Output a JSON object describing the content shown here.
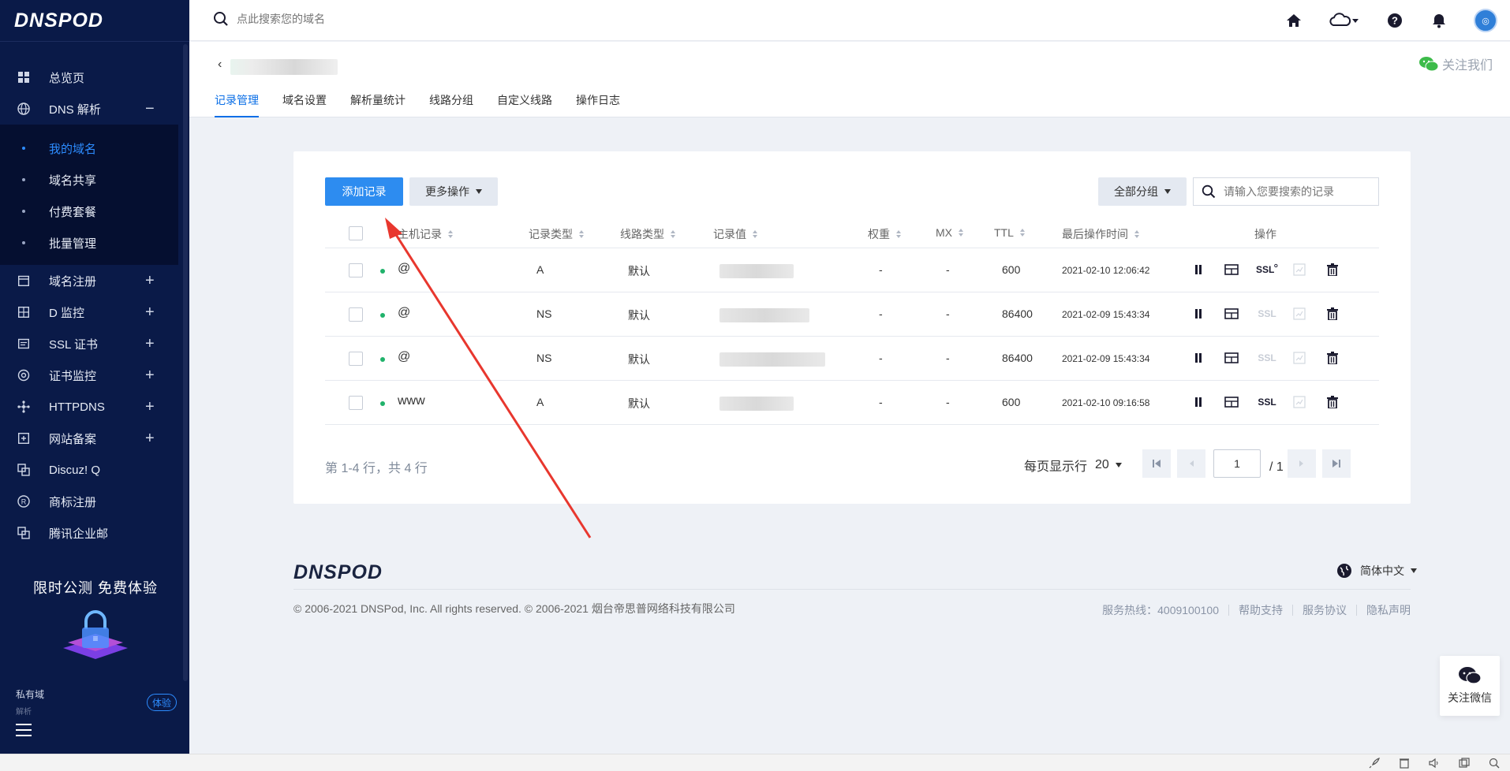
{
  "sidebar": {
    "logo": "DNSPOD",
    "items_top": [
      {
        "label": "总览页",
        "icon": "dashboard-icon"
      },
      {
        "label": "DNS 解析",
        "icon": "globe-icon",
        "toggle": "−"
      }
    ],
    "sub_items": [
      {
        "label": "我的域名",
        "active": true
      },
      {
        "label": "域名共享",
        "active": false
      },
      {
        "label": "付费套餐",
        "active": false
      },
      {
        "label": "批量管理",
        "active": false
      }
    ],
    "items_bottom": [
      {
        "label": "域名注册",
        "icon": "calendar-icon",
        "toggle": "+"
      },
      {
        "label": "D 监控",
        "icon": "monitor-icon",
        "toggle": "+"
      },
      {
        "label": "SSL 证书",
        "icon": "certificate-icon",
        "toggle": "+"
      },
      {
        "label": "证书监控",
        "icon": "target-icon",
        "toggle": "+"
      },
      {
        "label": "HTTPDNS",
        "icon": "network-icon",
        "toggle": "+"
      },
      {
        "label": "网站备案",
        "icon": "record-icon",
        "toggle": "+"
      },
      {
        "label": "Discuz! Q",
        "icon": "copy-icon",
        "toggle": ""
      },
      {
        "label": "商标注册",
        "icon": "registered-icon",
        "toggle": ""
      },
      {
        "label": "腾讯企业邮",
        "icon": "copy-icon",
        "toggle": ""
      }
    ],
    "promo_title": "限时公测  免费体验",
    "private_label": "私有域",
    "private_sub": "解析",
    "trial_badge": "体验"
  },
  "topbar": {
    "search_placeholder": "点此搜索您的域名"
  },
  "header": {
    "back_glyph": "‹",
    "follow_label": "关注我们",
    "tabs": [
      {
        "label": "记录管理",
        "active": true
      },
      {
        "label": "域名设置",
        "active": false
      },
      {
        "label": "解析量统计",
        "active": false
      },
      {
        "label": "线路分组",
        "active": false
      },
      {
        "label": "自定义线路",
        "active": false
      },
      {
        "label": "操作日志",
        "active": false
      }
    ]
  },
  "toolbar": {
    "add_record": "添加记录",
    "more_actions": "更多操作",
    "all_groups": "全部分组",
    "record_search_placeholder": "请输入您要搜索的记录"
  },
  "table": {
    "headers": {
      "host": "主机记录",
      "type": "记录类型",
      "line": "线路类型",
      "value": "记录值",
      "weight": "权重",
      "mx": "MX",
      "ttl": "TTL",
      "updated": "最后操作时间",
      "actions": "操作"
    },
    "rows": [
      {
        "host": "@",
        "type": "A",
        "line": "默认",
        "weight": "-",
        "mx": "-",
        "ttl": "600",
        "updated": "2021-02-10 12:06:42",
        "ssl": "SSL",
        "ssl_active": true
      },
      {
        "host": "@",
        "type": "NS",
        "line": "默认",
        "weight": "-",
        "mx": "-",
        "ttl": "86400",
        "updated": "2021-02-09 15:43:34",
        "ssl": "SSL",
        "ssl_active": false
      },
      {
        "host": "@",
        "type": "NS",
        "line": "默认",
        "weight": "-",
        "mx": "-",
        "ttl": "86400",
        "updated": "2021-02-09 15:43:34",
        "ssl": "SSL",
        "ssl_active": false
      },
      {
        "host": "www",
        "type": "A",
        "line": "默认",
        "weight": "-",
        "mx": "-",
        "ttl": "600",
        "updated": "2021-02-10 09:16:58",
        "ssl": "SSL",
        "ssl_active": true
      }
    ]
  },
  "pagination": {
    "summary": "第 1-4 行，共 4 行",
    "per_page_label": "每页显示行",
    "per_page_value": "20",
    "current_page": "1",
    "total_pages": "/ 1 页"
  },
  "footer": {
    "logo": "DNSPOD",
    "language": "简体中文",
    "copyright": "© 2006-2021 DNSPod, Inc. All rights reserved. © 2006-2021 烟台帝思普网络科技有限公司",
    "hotline": "服务热线：4009100100",
    "help": "帮助支持",
    "agreement": "服务协议",
    "privacy": "隐私声明"
  },
  "wechat_float": {
    "label": "关注微信"
  },
  "colors": {
    "sidebar_bg": "#0a1a48",
    "accent": "#2d8cf0",
    "annotation_arrow": "#e8372e",
    "status_green": "#20b26b"
  }
}
